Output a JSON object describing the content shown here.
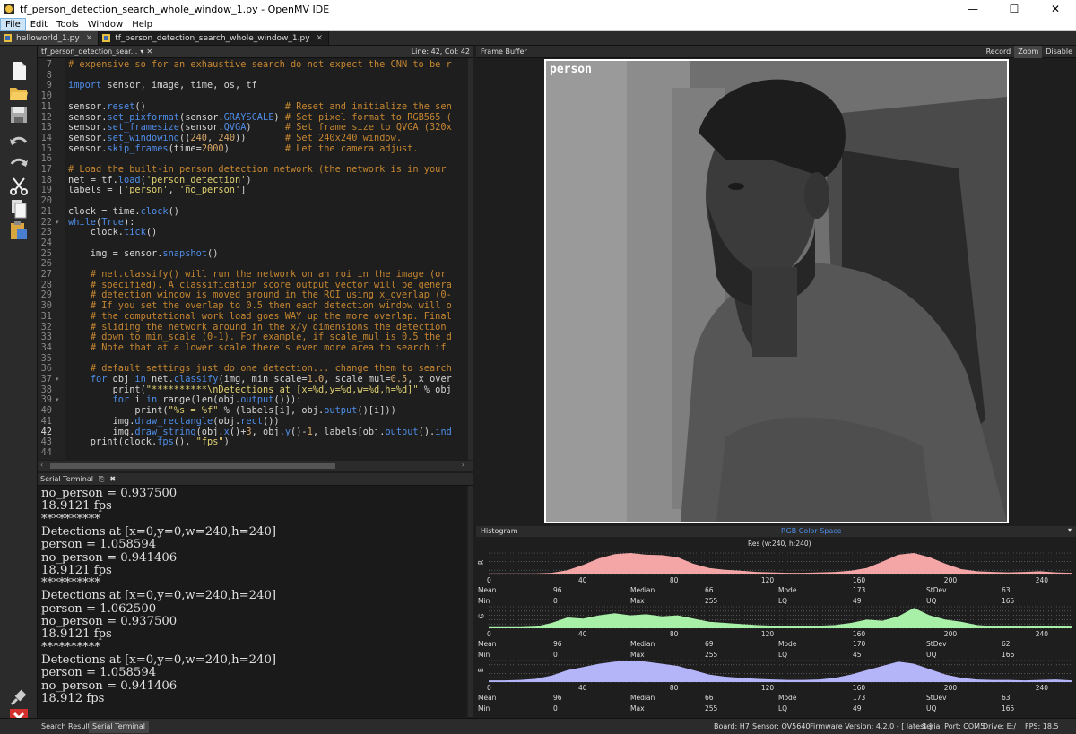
{
  "window": {
    "title": "tf_person_detection_search_whole_window_1.py - OpenMV IDE"
  },
  "menu": [
    "File",
    "Edit",
    "Tools",
    "Window",
    "Help"
  ],
  "file_tabs": [
    {
      "label": "helloworld_1.py"
    },
    {
      "label": "tf_person_detection_search_whole_window_1.py"
    }
  ],
  "editor": {
    "tab_label": "tf_person_detection_sear...",
    "cursor": "Line: 42, Col: 42",
    "current_line": 42,
    "lines": [
      {
        "n": 7,
        "code": "# expensive so for an exhaustive search do not expect the CNN to be r"
      },
      {
        "n": 8,
        "code": ""
      },
      {
        "n": 9,
        "code": "import sensor, image, time, os, tf"
      },
      {
        "n": 10,
        "code": ""
      },
      {
        "n": 11,
        "code": "sensor.reset()                         # Reset and initialize the sen"
      },
      {
        "n": 12,
        "code": "sensor.set_pixformat(sensor.GRAYSCALE) # Set pixel format to RGB565 ("
      },
      {
        "n": 13,
        "code": "sensor.set_framesize(sensor.QVGA)      # Set frame size to QVGA (320x"
      },
      {
        "n": 14,
        "code": "sensor.set_windowing((240, 240))       # Set 240x240 window."
      },
      {
        "n": 15,
        "code": "sensor.skip_frames(time=2000)          # Let the camera adjust."
      },
      {
        "n": 16,
        "code": ""
      },
      {
        "n": 17,
        "code": "# Load the built-in person detection network (the network is in your"
      },
      {
        "n": 18,
        "code": "net = tf.load('person_detection')"
      },
      {
        "n": 19,
        "code": "labels = ['person', 'no_person']"
      },
      {
        "n": 20,
        "code": ""
      },
      {
        "n": 21,
        "code": "clock = time.clock()"
      },
      {
        "n": 22,
        "code": "while(True):"
      },
      {
        "n": 23,
        "code": "    clock.tick()"
      },
      {
        "n": 24,
        "code": ""
      },
      {
        "n": 25,
        "code": "    img = sensor.snapshot()"
      },
      {
        "n": 26,
        "code": ""
      },
      {
        "n": 27,
        "code": "    # net.classify() will run the network on an roi in the image (or"
      },
      {
        "n": 28,
        "code": "    # specified). A classification score output vector will be genera"
      },
      {
        "n": 29,
        "code": "    # detection window is moved around in the ROI using x_overlap (0-"
      },
      {
        "n": 30,
        "code": "    # If you set the overlap to 0.5 then each detection window will o"
      },
      {
        "n": 31,
        "code": "    # the computational work load goes WAY up the more overlap. Final"
      },
      {
        "n": 32,
        "code": "    # sliding the network around in the x/y dimensions the detection"
      },
      {
        "n": 33,
        "code": "    # down to min_scale (0-1). For example, if scale_mul is 0.5 the d"
      },
      {
        "n": 34,
        "code": "    # Note that at a lower scale there's even more area to search if"
      },
      {
        "n": 35,
        "code": ""
      },
      {
        "n": 36,
        "code": "    # default settings just do one detection... change them to search"
      },
      {
        "n": 37,
        "code": "    for obj in net.classify(img, min_scale=1.0, scale_mul=0.5, x_over"
      },
      {
        "n": 38,
        "code": "        print(\"**********\\nDetections at [x=%d,y=%d,w=%d,h=%d]\" % obj"
      },
      {
        "n": 39,
        "code": "        for i in range(len(obj.output())):"
      },
      {
        "n": 40,
        "code": "            print(\"%s = %f\" % (labels[i], obj.output()[i]))"
      },
      {
        "n": 41,
        "code": "        img.draw_rectangle(obj.rect())"
      },
      {
        "n": 42,
        "code": "        img.draw_string(obj.x()+3, obj.y()-1, labels[obj.output().ind"
      },
      {
        "n": 43,
        "code": "    print(clock.fps(), \"fps\")"
      },
      {
        "n": 44,
        "code": ""
      }
    ]
  },
  "serial": {
    "title": "Serial Terminal",
    "lines": [
      "no_person = 0.937500",
      "18.9121 fps",
      "**********",
      "Detections at [x=0,y=0,w=240,h=240]",
      "person = 1.058594",
      "no_person = 0.941406",
      "18.9121 fps",
      "**********",
      "Detections at [x=0,y=0,w=240,h=240]",
      "person = 1.062500",
      "no_person = 0.937500",
      "18.9121 fps",
      "**********",
      "Detections at [x=0,y=0,w=240,h=240]",
      "person = 1.058594",
      "no_person = 0.941406",
      "18.912 fps"
    ]
  },
  "framebuffer": {
    "title": "Frame Buffer",
    "record": "Record",
    "zoom": "Zoom",
    "disable": "Disable",
    "detection_label": "person"
  },
  "histogram": {
    "title": "Histogram",
    "colorspace": "RGB Color Space",
    "res": "Res (w:240, h:240)",
    "ticks": [
      "0",
      "40",
      "80",
      "120",
      "160",
      "200",
      "240"
    ],
    "channels": [
      {
        "name": "R",
        "color": "#f4a6a6",
        "mean": "96",
        "median": "66",
        "mode": "173",
        "stdev": "63",
        "min": "0",
        "max": "255",
        "lq": "49",
        "uq": "165",
        "shape": [
          0.05,
          0.05,
          0.05,
          0.05,
          0.08,
          0.2,
          0.45,
          0.75,
          0.95,
          1.0,
          0.92,
          0.9,
          0.8,
          0.5,
          0.3,
          0.22,
          0.18,
          0.12,
          0.1,
          0.08,
          0.08,
          0.1,
          0.12,
          0.18,
          0.3,
          0.6,
          0.92,
          1.0,
          0.8,
          0.5,
          0.25,
          0.15,
          0.12,
          0.1,
          0.12,
          0.15,
          0.1,
          0.08
        ]
      },
      {
        "name": "G",
        "color": "#a8f0a8",
        "mean": "96",
        "median": "69",
        "mode": "170",
        "stdev": "62",
        "min": "0",
        "max": "255",
        "lq": "45",
        "uq": "166",
        "shape": [
          0.05,
          0.05,
          0.05,
          0.08,
          0.25,
          0.5,
          0.45,
          0.6,
          0.7,
          0.6,
          0.65,
          0.55,
          0.6,
          0.45,
          0.3,
          0.25,
          0.2,
          0.15,
          0.12,
          0.1,
          0.1,
          0.12,
          0.15,
          0.25,
          0.4,
          0.35,
          0.55,
          0.95,
          0.6,
          0.4,
          0.3,
          0.15,
          0.1,
          0.1,
          0.08,
          0.1,
          0.1,
          0.08
        ]
      },
      {
        "name": "B",
        "color": "#b4b4f8",
        "mean": "96",
        "median": "66",
        "mode": "173",
        "stdev": "63",
        "min": "0",
        "max": "255",
        "lq": "49",
        "uq": "165",
        "shape": [
          0.08,
          0.08,
          0.1,
          0.15,
          0.3,
          0.55,
          0.7,
          0.85,
          0.95,
          1.0,
          0.95,
          0.85,
          0.75,
          0.55,
          0.35,
          0.25,
          0.2,
          0.15,
          0.12,
          0.1,
          0.1,
          0.12,
          0.2,
          0.35,
          0.55,
          0.75,
          0.95,
          0.85,
          0.6,
          0.35,
          0.2,
          0.12,
          0.1,
          0.1,
          0.08,
          0.1,
          0.12,
          0.08
        ]
      }
    ]
  },
  "statusbar": {
    "tab1": "Search Results",
    "tab2": "Serial Terminal",
    "board": "Board: H7",
    "sensor": "Sensor: OV5640",
    "firmware": "Firmware Version: 4.2.0 - [ latest ]",
    "port": "Serial Port: COM5",
    "drive": "Drive: E:/",
    "fps": "FPS: 18.5"
  }
}
